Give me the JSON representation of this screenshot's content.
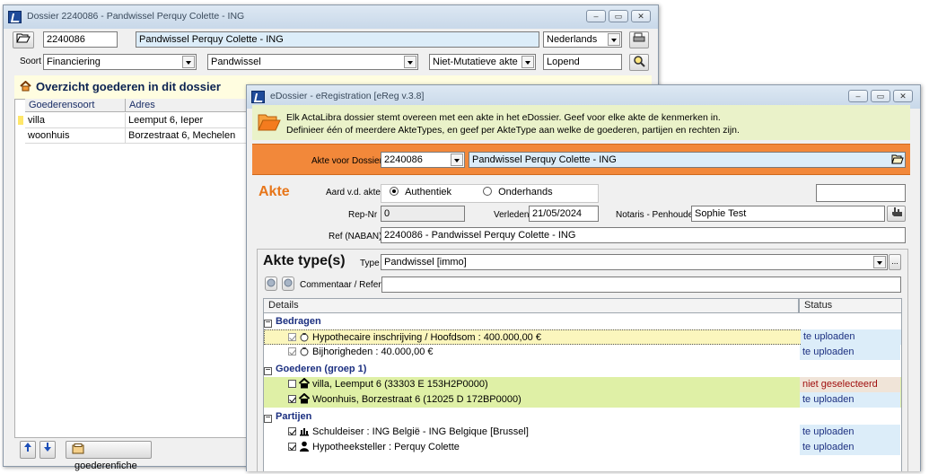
{
  "back_window": {
    "title": "Dossier 2240086 - Pandwissel Perquy Colette - ING",
    "dossier_nr": "2240086",
    "dossier_name": "Pandwissel Perquy Colette - ING",
    "language": "Nederlands",
    "soort_label": "Soort",
    "soort_value": "Financiering",
    "subtype_value": "Pandwissel",
    "akte_kind": "Niet-Mutatieve akte",
    "state": "Lopend",
    "panel_title": "Overzicht goederen in dit dossier",
    "columns": [
      "Goederensoort",
      "Adres"
    ],
    "rows": [
      [
        "villa",
        "Leemput 6, Ieper"
      ],
      [
        "woonhuis",
        "Borzestraat 6, Mechelen"
      ]
    ],
    "goederenfiche_label": "goederenfiche",
    "window_buttons": [
      "‒",
      "▭",
      "✕"
    ]
  },
  "front_window": {
    "title": "eDossier - eRegistration [eReg v.3.8]",
    "window_buttons": [
      "‒",
      "▭",
      "✕"
    ],
    "info_line1": "Elk ActaLibra dossier stemt overeen met een akte in het eDossier. Geef voor elke akte de kenmerken in.",
    "info_line2": "Definieer één of meerdere AkteTypes, en geef per AkteType aan welke de goederen, partijen en rechten zijn.",
    "akte_voor_dossier_label": "Akte voor Dossier",
    "akte_voor_dossier_value": "2240086",
    "akte_voor_dossier_name": "Pandwissel Perquy Colette - ING",
    "akte_title": "Akte",
    "aard_label": "Aard v.d. akte",
    "aard_options": [
      "Authentiek",
      "Onderhands"
    ],
    "aard_selected": "Authentiek",
    "repnr_label": "Rep-Nr",
    "repnr_value": "0",
    "verleden_label": "Verleden",
    "verleden_value": "21/05/2024",
    "notaris_label": "Notaris - Penhouder",
    "notaris_value": "Sophie Test",
    "ref_label": "Ref (NABAN)",
    "ref_value": "2240086 - Pandwissel Perquy Colette - ING",
    "aktetypes_title": "Akte type(s)",
    "type_label": "Type",
    "type_value": "Pandwissel [immo]",
    "more_label": "...",
    "commentaar_label": "Commentaar / Referte",
    "commentaar_value": "",
    "table_headers": [
      "Details",
      "Status"
    ],
    "groups": [
      {
        "name": "Bedragen",
        "items": [
          {
            "text": "Hypothecaire inschrijving / Hoofdsom : 400.000,00 €",
            "status": "te uploaden",
            "checked": true,
            "disabled": true,
            "icon": "money-bag-icon",
            "highlight": "yellow"
          },
          {
            "text": "Bijhorigheden : 40.000,00 €",
            "status": "te uploaden",
            "checked": true,
            "disabled": true,
            "icon": "money-bag-icon",
            "highlight": "none"
          }
        ]
      },
      {
        "name": "Goederen (groep 1)",
        "items": [
          {
            "text": "villa, Leemput 6 (33303 E 153H2P0000)",
            "status": "niet geselecteerd",
            "checked": false,
            "disabled": false,
            "icon": "house-icon",
            "highlight": "green"
          },
          {
            "text": "Woonhuis, Borzestraat 6 (12025 D 172BP0000)",
            "status": "te uploaden",
            "checked": true,
            "disabled": false,
            "icon": "house-icon",
            "highlight": "green"
          }
        ]
      },
      {
        "name": "Partijen",
        "items": [
          {
            "text": "Schuldeiser : ING België - ING Belgique [Brussel]",
            "status": "te uploaden",
            "checked": true,
            "disabled": false,
            "icon": "bank-icon",
            "highlight": "none"
          },
          {
            "text": "Hypotheeksteller : Perquy Colette",
            "status": "te uploaden",
            "checked": true,
            "disabled": false,
            "icon": "person-icon",
            "highlight": "none"
          }
        ]
      }
    ],
    "colors": {
      "info_band": "#eaf2c9",
      "orange_band": "#f2883a",
      "status_blue": "#dcedf9",
      "status_red": "#f0e4d8",
      "row_yellow": "#fbf6bd",
      "row_green": "#dff0a6"
    }
  }
}
